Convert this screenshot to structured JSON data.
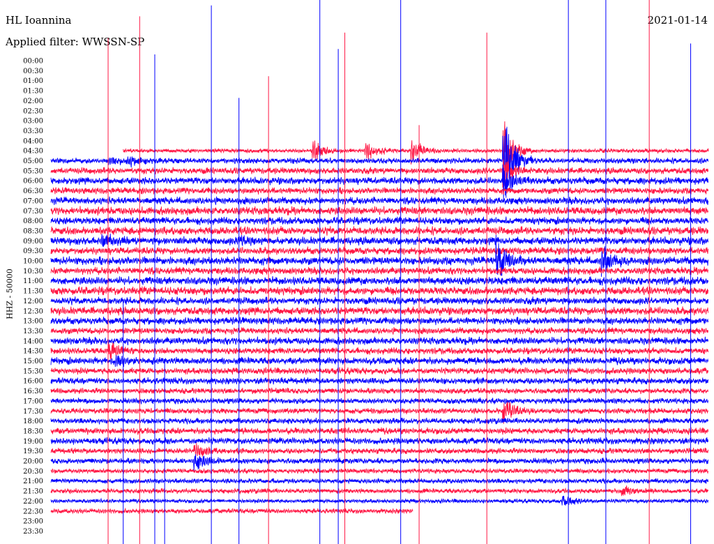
{
  "header": {
    "station": "HL Ioannina",
    "filter": "Applied filter: WWSSN-SP",
    "date": "2021-01-14"
  },
  "chart_data": {
    "type": "line",
    "title": "HL Ioannina",
    "ylabel": "HHZ - 50000",
    "colors": [
      "#ff1744",
      "#0000ff"
    ],
    "row_labels": [
      "00:00",
      "00:30",
      "01:00",
      "01:30",
      "02:00",
      "02:30",
      "03:00",
      "03:30",
      "04:00",
      "04:30",
      "05:00",
      "05:30",
      "06:00",
      "06:30",
      "07:00",
      "07:30",
      "08:00",
      "08:30",
      "09:00",
      "09:30",
      "10:00",
      "10:30",
      "11:00",
      "11:30",
      "12:00",
      "12:30",
      "13:00",
      "13:30",
      "14:00",
      "14:30",
      "15:00",
      "15:30",
      "16:00",
      "16:30",
      "17:00",
      "17:30",
      "18:00",
      "18:30",
      "19:00",
      "19:30",
      "20:00",
      "20:30",
      "21:00",
      "21:30",
      "22:00",
      "22:30",
      "23:00",
      "23:30"
    ],
    "data_start_row": 9,
    "data_end_row": 45,
    "partial_start_fraction": 0.11,
    "partial_end_fraction": 0.55,
    "row_noise": [
      0.25,
      0.35,
      0.4,
      0.45,
      0.4,
      0.45,
      0.5,
      0.45,
      0.5,
      0.5,
      0.45,
      0.5,
      0.45,
      0.5,
      0.5,
      0.45,
      0.5,
      0.45,
      0.4,
      0.45,
      0.4,
      0.45,
      0.4,
      0.4,
      0.35,
      0.35,
      0.35,
      0.35,
      0.4,
      0.4,
      0.35,
      0.35,
      0.3,
      0.3,
      0.3,
      0.25,
      0.3
    ],
    "spikes": [
      {
        "row": 9,
        "x": 0.4,
        "up": 20
      },
      {
        "row": 9,
        "x": 0.48,
        "up": 18
      },
      {
        "row": 9,
        "x": 0.69,
        "up": 60
      },
      {
        "row": 9,
        "x": 0.55,
        "up": 22
      },
      {
        "row": 10,
        "x": 0.69,
        "up": 90
      },
      {
        "row": 10,
        "x": 0.09,
        "up": 6
      },
      {
        "row": 10,
        "x": 0.12,
        "up": 8
      },
      {
        "row": 11,
        "x": 0.69,
        "up": 30
      },
      {
        "row": 12,
        "x": 0.69,
        "up": 25
      },
      {
        "row": 18,
        "x": 0.08,
        "up": 10
      },
      {
        "row": 18,
        "x": 0.29,
        "up": 8
      },
      {
        "row": 20,
        "x": 0.68,
        "up": 40
      },
      {
        "row": 20,
        "x": 0.84,
        "up": 25
      },
      {
        "row": 29,
        "x": 0.09,
        "up": 15
      },
      {
        "row": 30,
        "x": 0.1,
        "up": 12
      },
      {
        "row": 35,
        "x": 0.69,
        "up": 22
      },
      {
        "row": 39,
        "x": 0.22,
        "up": 14
      },
      {
        "row": 40,
        "x": 0.22,
        "up": 18
      },
      {
        "row": 43,
        "x": 0.87,
        "up": 10
      },
      {
        "row": 44,
        "x": 0.78,
        "up": 10
      }
    ],
    "long_lines": [
      {
        "x": 0.087,
        "top": 0.07,
        "color": "#ff1744"
      },
      {
        "x": 0.11,
        "top": 0.55,
        "color": "#0000ff"
      },
      {
        "x": 0.135,
        "top": 0.03,
        "color": "#ff1744"
      },
      {
        "x": 0.158,
        "top": 0.1,
        "color": "#0000ff"
      },
      {
        "x": 0.173,
        "top": 0.66,
        "color": "#0000ff"
      },
      {
        "x": 0.244,
        "top": 0.01,
        "color": "#0000ff"
      },
      {
        "x": 0.286,
        "top": 0.18,
        "color": "#0000ff"
      },
      {
        "x": 0.331,
        "top": 0.14,
        "color": "#ff1744"
      },
      {
        "x": 0.409,
        "top": 0.0,
        "color": "#0000ff"
      },
      {
        "x": 0.437,
        "top": 0.09,
        "color": "#0000ff"
      },
      {
        "x": 0.447,
        "top": 0.06,
        "color": "#ff1744"
      },
      {
        "x": 0.532,
        "top": 0.0,
        "color": "#0000ff"
      },
      {
        "x": 0.56,
        "top": 0.23,
        "color": "#ff1744"
      },
      {
        "x": 0.663,
        "top": 0.06,
        "color": "#ff1744"
      },
      {
        "x": 0.787,
        "top": 0.0,
        "color": "#0000ff"
      },
      {
        "x": 0.844,
        "top": 0.0,
        "color": "#0000ff"
      },
      {
        "x": 0.91,
        "top": 0.0,
        "color": "#ff1744"
      },
      {
        "x": 0.973,
        "top": 0.08,
        "color": "#0000ff"
      }
    ]
  }
}
